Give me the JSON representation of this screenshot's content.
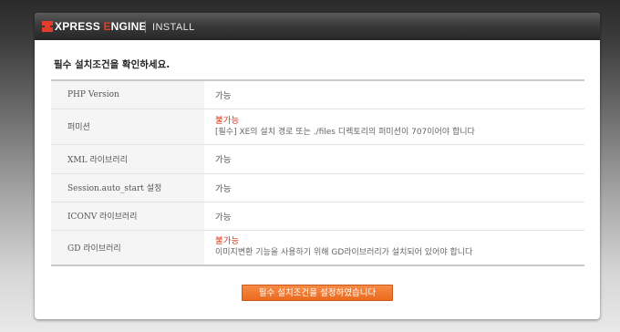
{
  "header": {
    "logo_x": "X",
    "logo_press": "PRESS ",
    "logo_e": "E",
    "logo_ngine": "NGINE",
    "title": "INSTALL"
  },
  "heading": "필수 설치조건을 확인하세요.",
  "requirements": [
    {
      "label": "PHP Version",
      "status": "가능",
      "message": ""
    },
    {
      "label": "퍼미션",
      "status": "불가능",
      "message": "[필수] XE의 설치 경로 또는 ./files 디렉토리의 퍼미션이 707이어야 합니다"
    },
    {
      "label": "XML 라이브러리",
      "status": "가능",
      "message": ""
    },
    {
      "label": "Session.auto_start 설정",
      "status": "가능",
      "message": ""
    },
    {
      "label": "ICONV 라이브러리",
      "status": "가능",
      "message": ""
    },
    {
      "label": "GD 라이브러리",
      "status": "불가능",
      "message": "이미지변환 기능을 사용하기 위해 GD라이브러리가 설치되어 있어야 합니다"
    }
  ],
  "button_label": "필수 설치조건을 설정하였습니다",
  "colors": {
    "accent": "#e43b2a",
    "fail": "#d63b1e",
    "button": "#ec6a1f"
  }
}
